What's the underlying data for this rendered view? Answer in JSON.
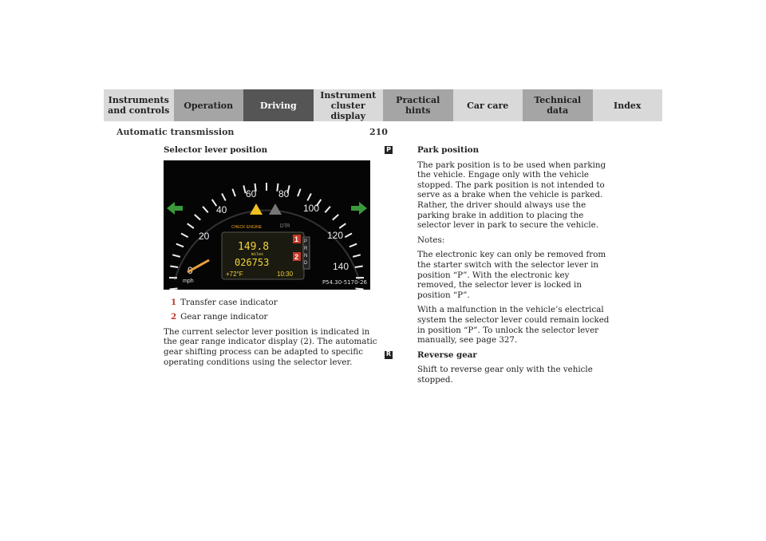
{
  "nav": {
    "tabs": [
      {
        "line1": "Instruments",
        "line2": "and controls"
      },
      {
        "line1": "Operation",
        "line2": ""
      },
      {
        "line1": "Driving",
        "line2": ""
      },
      {
        "line1": "Instrument",
        "line2": "cluster display"
      },
      {
        "line1": "Practical hints",
        "line2": ""
      },
      {
        "line1": "Car care",
        "line2": ""
      },
      {
        "line1": "Technical",
        "line2": "data"
      },
      {
        "line1": "Index",
        "line2": ""
      }
    ]
  },
  "header": {
    "section": "Automatic transmission",
    "page": "210"
  },
  "left": {
    "heading": "Selector lever position",
    "figure": {
      "speed_labels": [
        "20",
        "40",
        "60",
        "80",
        "100",
        "120",
        "140"
      ],
      "zero": "0",
      "unit": "mph",
      "odometer_trip": "149.8",
      "odometer_unit": "miles",
      "odometer_total": "026753",
      "temperature": "+72°F",
      "clock": "10:30",
      "callout_1": "1",
      "callout_2": "2",
      "gears": [
        "P",
        "R",
        "N",
        "D"
      ],
      "check_engine": "CHECK ENGINE",
      "dtr": "DTR",
      "code": "P54.30-5170-26"
    },
    "legend": [
      {
        "num": "1",
        "text": "Transfer case indicator"
      },
      {
        "num": "2",
        "text": "Gear range indicator"
      }
    ],
    "body": "The current selector lever position is indicated in the gear range indicator display (2). The automatic gear shifting process can be adapted to specific operating conditions using the selector lever."
  },
  "right": {
    "park": {
      "marker": "P",
      "title": "Park position",
      "p1": "The park position is to be used when parking the vehicle. Engage only with the vehicle stopped. The park position is not intended to serve as a brake when the vehicle is parked. Rather, the driver should always use the parking brake in addition to placing the selector lever in park to secure the vehicle.",
      "notes": "Notes:",
      "p2": "The electronic key can only be removed from the starter switch with the selector lever in position “P”. With the electronic key removed, the selector lever is locked in position “P”.",
      "p3": "With a malfunction in the vehicle’s electrical system the selector lever could remain locked in position “P”. To unlock the selector lever manually, see page 327."
    },
    "reverse": {
      "marker": "R",
      "title": "Reverse gear",
      "p1": "Shift to reverse gear only with the vehicle stopped."
    }
  },
  "colors": {
    "tab_active": "#555555",
    "arrow": "#3a9a3a",
    "needle": "#e8a040",
    "lcd": "#f3d23a",
    "callout": "#c0392b"
  }
}
